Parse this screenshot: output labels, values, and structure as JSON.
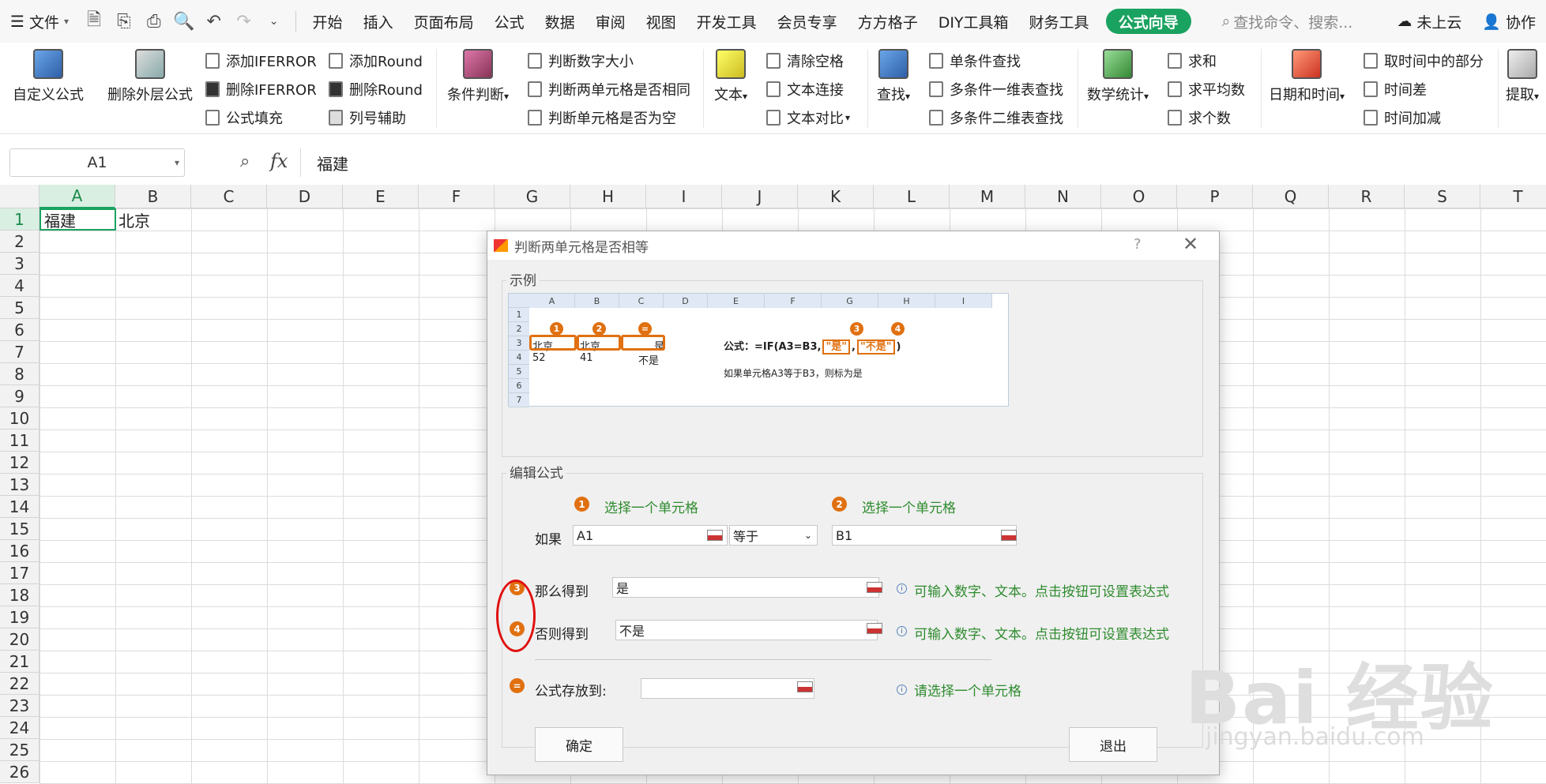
{
  "menubar": {
    "file_label": "文件",
    "tabs": [
      "开始",
      "插入",
      "页面布局",
      "公式",
      "数据",
      "审阅",
      "视图",
      "开发工具",
      "会员专享",
      "方方格子",
      "DIY工具箱",
      "财务工具"
    ],
    "active_tab": "公式向导",
    "search_placeholder": "查找命令、搜索...",
    "cloud_label": "未上云",
    "collab_label": "协作"
  },
  "ribbon": {
    "custom_formula": "自定义公式",
    "remove_outer": "删除外层公式",
    "add_iferror": "添加IFERROR",
    "del_iferror": "删除IFERROR",
    "formula_fill": "公式填充",
    "add_round": "添加Round",
    "del_round": "删除Round",
    "col_helper": "列号辅助",
    "cond_judge": "条件判断",
    "judge_num_size": "判断数字大小",
    "judge_two_cells": "判断两单元格是否相同",
    "judge_cell_empty": "判断单元格是否为空",
    "text": "文本",
    "clear_space": "清除空格",
    "text_concat": "文本连接",
    "text_compare": "文本对比",
    "find": "查找",
    "single_find": "单条件查找",
    "multi_1d_find": "多条件一维表查找",
    "multi_2d_find": "多条件二维表查找",
    "math_stats": "数学统计",
    "sum": "求和",
    "avg": "求平均数",
    "count": "求个数",
    "datetime": "日期和时间",
    "time_part": "取时间中的部分",
    "time_diff": "时间差",
    "time_add": "时间加减",
    "extract": "提取"
  },
  "formula_bar": {
    "name_box": "A1",
    "value": "福建"
  },
  "sheet": {
    "columns": [
      "A",
      "B",
      "C",
      "D",
      "E",
      "F",
      "G",
      "H",
      "I",
      "J",
      "K",
      "L",
      "M",
      "N",
      "O",
      "P",
      "Q",
      "R",
      "S",
      "T"
    ],
    "rows": [
      "1",
      "2",
      "3",
      "4",
      "5",
      "6",
      "7",
      "8",
      "9",
      "10",
      "11",
      "12",
      "13",
      "14",
      "15",
      "16",
      "17",
      "18",
      "19",
      "20",
      "21",
      "22",
      "23",
      "24",
      "25",
      "26"
    ],
    "a1": "福建",
    "b1": "北京"
  },
  "dialog": {
    "title": "判断两单元格是否相等",
    "help": "?",
    "example_label": "示例",
    "example": {
      "cols": [
        "A",
        "B",
        "C",
        "D",
        "E",
        "F",
        "G",
        "H",
        "I"
      ],
      "rows": [
        "1",
        "2",
        "3",
        "4",
        "5",
        "6",
        "7"
      ],
      "r3a": "北京",
      "r3b": "北京",
      "r3c": "是",
      "r4a": "52",
      "r4b": "41",
      "r4c": "不是",
      "formula_prefix": "公式：=IF(A3=B3,",
      "yes_q": "\"是\"",
      "no_q": "\"不是\"",
      "close_paren": ")",
      "comma": ",",
      "desc": "如果单元格A3等于B3，则标为是",
      "n1": "1",
      "n2": "2",
      "n3": "3",
      "n4": "4",
      "neq": "="
    },
    "edit_label": "编辑公式",
    "select_cell_1": "选择一个单元格",
    "select_cell_2": "选择一个单元格",
    "step1": "1",
    "step2": "2",
    "step3": "3",
    "step4": "4",
    "step5": "=",
    "if_label": "如果",
    "cell1_value": "A1",
    "op_value": "等于",
    "cell2_value": "B1",
    "then_label": "那么得到",
    "then_value": "是",
    "hint_then": "可输入数字、文本。点击按钮可设置表达式",
    "else_label": "否则得到",
    "else_value": "不是",
    "hint_else": "可输入数字、文本。点击按钮可设置表达式",
    "store_label": "公式存放到:",
    "store_value": "",
    "hint_store": "请选择一个单元格",
    "ok": "确定",
    "exit": "退出"
  },
  "watermark": {
    "brand": "Bai 经验",
    "url": "jingyan.baidu.com"
  }
}
